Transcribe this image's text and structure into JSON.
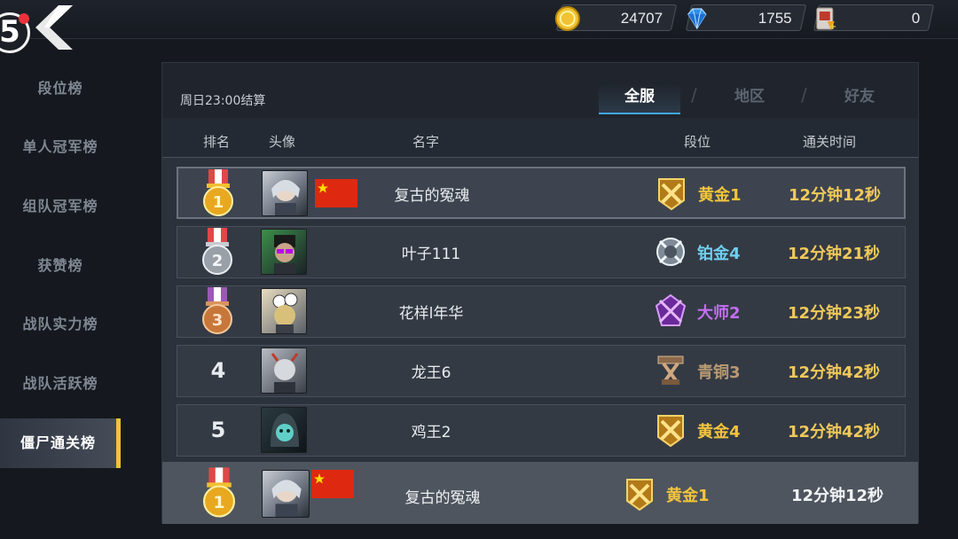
{
  "topbar": {
    "app_badge": "5",
    "gold": "24707",
    "diamond": "1755",
    "ticket": "0"
  },
  "sidebar": {
    "items": [
      {
        "label": "段位榜"
      },
      {
        "label": "单人冠军榜"
      },
      {
        "label": "组队冠军榜"
      },
      {
        "label": "获赞榜"
      },
      {
        "label": "战队实力榜"
      },
      {
        "label": "战队活跃榜"
      },
      {
        "label": "僵尸通关榜"
      }
    ],
    "active_index": 6
  },
  "panel": {
    "settle_text": "周日23:00结算",
    "tabs": [
      {
        "label": "全服"
      },
      {
        "label": "地区"
      },
      {
        "label": "好友"
      }
    ],
    "separators": [
      "/",
      "/"
    ],
    "columns": {
      "rank": "排名",
      "avatar": "头像",
      "name": "名字",
      "tier": "段位",
      "time": "通关时间"
    }
  },
  "rows": [
    {
      "rank": "1",
      "medal": "gold-medal-icon",
      "name": "复古的冤魂",
      "flag": "china-flag-icon",
      "tier": "黄金1",
      "tier_icon": "gold-tier-icon",
      "tier_color": "#f2c43c",
      "time": "12分钟12秒"
    },
    {
      "rank": "2",
      "medal": "silver-medal-icon",
      "name": "叶子111",
      "tier": "铂金4",
      "tier_icon": "platinum-tier-icon",
      "tier_color": "#6fd0ee",
      "time": "12分钟21秒"
    },
    {
      "rank": "3",
      "medal": "bronze-medal-icon",
      "name": "花样l年华",
      "tier": "大师2",
      "tier_icon": "master-tier-icon",
      "tier_color": "#c36ef0",
      "time": "12分钟23秒"
    },
    {
      "rank": "4",
      "name": "龙王6",
      "tier": "青铜3",
      "tier_icon": "bronze-tier-icon",
      "tier_color": "#b89a74",
      "time": "12分钟42秒"
    },
    {
      "rank": "5",
      "name": "鸡王2",
      "tier": "黄金4",
      "tier_icon": "gold-tier-icon",
      "tier_color": "#f2c43c",
      "time": "12分钟42秒"
    }
  ],
  "me": {
    "rank": "1",
    "medal": "gold-medal-icon",
    "name": "复古的冤魂",
    "flag": "china-flag-icon",
    "tier": "黄金1",
    "tier_color": "#f2c43c",
    "time": "12分钟12秒"
  },
  "colors": {
    "accent_tab": "#3fa6e6",
    "sidebar_active": "#f2c23b",
    "gold": "#f0c95a"
  }
}
